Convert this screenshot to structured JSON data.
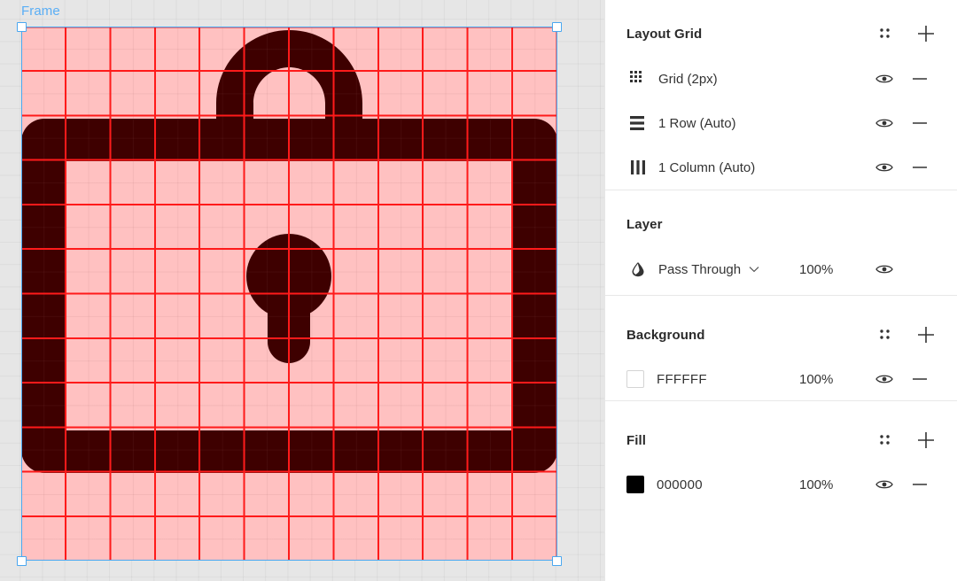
{
  "canvas": {
    "frame_label": "Frame",
    "selection_color": "#4aa7f0",
    "grid_color": "#ff1a1a",
    "artwork_name": "lock-icon",
    "artwork_fill": "#000000",
    "frame_background": "#FFFFFF"
  },
  "panel": {
    "layout_grid": {
      "title": "Layout Grid",
      "actions": {
        "settings_label": "⁚⁚",
        "add_label": "+"
      },
      "items": [
        {
          "icon": "grid-dots-icon",
          "label": "Grid (2px)",
          "visible": true
        },
        {
          "icon": "rows-icon",
          "label": "1 Row (Auto)",
          "visible": true
        },
        {
          "icon": "columns-icon",
          "label": "1 Column (Auto)",
          "visible": true
        }
      ]
    },
    "layer": {
      "title": "Layer",
      "blend_mode": "Pass Through",
      "opacity": "100%",
      "icon": "blend-droplet-icon"
    },
    "background": {
      "title": "Background",
      "actions": {
        "settings_label": "⁚⁚",
        "add_label": "+"
      },
      "items": [
        {
          "color": "#FFFFFF",
          "hex": "FFFFFF",
          "opacity": "100%",
          "visible": true
        }
      ]
    },
    "fill": {
      "title": "Fill",
      "actions": {
        "settings_label": "⁚⁚",
        "add_label": "+"
      },
      "items": [
        {
          "color": "#000000",
          "hex": "000000",
          "opacity": "100%",
          "visible": true
        }
      ]
    }
  }
}
